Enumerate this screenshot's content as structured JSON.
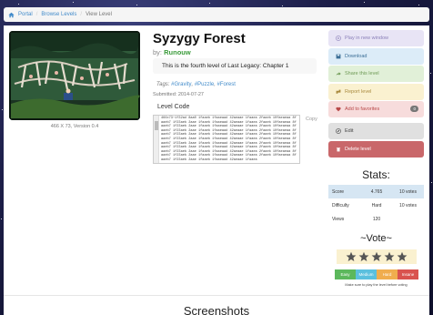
{
  "breadcrumb": {
    "icon": "home-icon",
    "items": [
      "Portal",
      "Browse Levels",
      "View Level"
    ]
  },
  "level": {
    "title": "Syzygy Forest",
    "by_prefix": "by:",
    "author": "Runouw",
    "description": "This is the fourth level of Last Legacy: Chapter 1",
    "tags_label": "Tags:",
    "tags": [
      "#Gravity",
      "#Puzzle",
      "#Forest"
    ],
    "submitted": "Submitted: 2014-07-27",
    "thumb_caption": "466 X 73, Version 0.4",
    "code_label": "Level Code",
    "copy_label": "Copy",
    "code_text": "466x73~1f32ad 8aa0 1faaeb 1faaeaad 42aeaae 1faaea 2faaeb 10faeaeaa 8faaeb7 1f23aeb 2aae 1faaeb 1faaeaad 42aeaae 1faaea 2faaeb 10faeaeaa 8faaeb7 1f23aeb 2aae 1faaeb 1faaeaad 42aeaae 1faaea 2faaeb 10faeaeaa 8faaeb7 1f23aeb 2aae 1faaeb 1faaeaad 42aeaae 1faaea 2faaeb 10faeaeaa 8faaeb7 1f23aeb 2aae 1faaeb 1faaeaad 42aeaae 1faaea 2faaeb 10faeaeaa 8faaeb7 1f23aeb 2aae 1faaeb 1faaeaad 42aeaae 1faaea 2faaeb 10faeaeaa 8faaeb7 1f23aeb 2aae 1faaeb 1faaeaad 42aeaae 1faaea 2faaeb 10faeaeaa 8faaeb7 1f23aeb 2aae 1faaeb 1faaeaad 42aeaae 1faaea 2faaeb 10faeaeaa 8faaeb7 1f23aeb 2aae 1faaeb 1faaeaad 42aeaae 1faaea 2faaeb 10faeaeaa 8faaeb7 1f23aeb 2aae 1faaeb 1faaeaad 42aeaae 1faaea 2faaeb 10faeaeaa 8faaeb7 1f23aeb 2aae 1faaeb 1faaeaad 42aeaae 1faaea"
  },
  "actions": {
    "play": {
      "label": "Play in new window",
      "icon": "play-icon"
    },
    "download": {
      "label": "Download",
      "icon": "save-icon"
    },
    "share": {
      "label": "Share this level",
      "icon": "share-icon"
    },
    "report": {
      "label": "Report level",
      "icon": "flag-icon"
    },
    "favorite": {
      "label": "Add to favorites",
      "icon": "heart-icon",
      "count": "0"
    },
    "edit": {
      "label": "Edit",
      "icon": "edit-icon"
    },
    "delete": {
      "label": "Delete level",
      "icon": "trash-icon"
    }
  },
  "stats": {
    "title": "Stats:",
    "rows": [
      {
        "label": "Score",
        "value": "4.765",
        "votes": "10 votes"
      },
      {
        "label": "Difficulty",
        "value": "Hard",
        "votes": "10 votes"
      },
      {
        "label": "Views",
        "value": "120",
        "votes": ""
      }
    ]
  },
  "vote": {
    "title": "~Vote~",
    "star_count": 5,
    "difficulties": [
      "Easy",
      "Medium",
      "Hard",
      "Insane"
    ],
    "note": "Make sure to play the level before voting"
  },
  "screenshots": {
    "title": "Screenshots"
  },
  "colors": {
    "link": "#428bca",
    "author": "#3a9b3a",
    "delete": "#c9676a",
    "star": "#555555"
  }
}
